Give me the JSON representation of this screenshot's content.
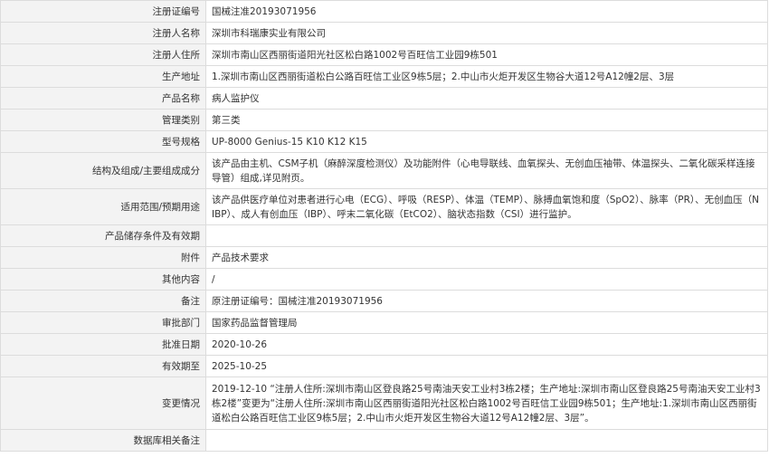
{
  "rows": [
    {
      "label": "注册证编号",
      "value": "国械注准20193071956"
    },
    {
      "label": "注册人名称",
      "value": "深圳市科瑞康实业有限公司"
    },
    {
      "label": "注册人住所",
      "value": "深圳市南山区西丽街道阳光社区松白路1002号百旺信工业园9栋501"
    },
    {
      "label": "生产地址",
      "value": "1.深圳市南山区西丽街道松白公路百旺信工业区9栋5层；2.中山市火炬开发区生物谷大道12号A12幢2层、3层"
    },
    {
      "label": "产品名称",
      "value": "病人监护仪"
    },
    {
      "label": "管理类别",
      "value": "第三类"
    },
    {
      "label": "型号规格",
      "value": "UP-8000 Genius-15 K10 K12 K15"
    },
    {
      "label": "结构及组成/主要组成成分",
      "value": "该产品由主机、CSM子机（麻醉深度检测仪）及功能附件（心电导联线、血氧探头、无创血压袖带、体温探头、二氧化碳采样连接导管）组成,详见附页。"
    },
    {
      "label": "适用范围/预期用途",
      "value": "该产品供医疗单位对患者进行心电（ECG）、呼吸（RESP）、体温（TEMP）、脉搏血氧饱和度（SpO2）、脉率（PR）、无创血压（NIBP）、成人有创血压（IBP）、呼末二氧化碳（EtCO2）、脑状态指数（CSI）进行监护。"
    },
    {
      "label": "产品储存条件及有效期",
      "value": ""
    },
    {
      "label": "附件",
      "value": "产品技术要求"
    },
    {
      "label": "其他内容",
      "value": "/"
    },
    {
      "label": "备注",
      "value": "原注册证编号：国械注准20193071956"
    },
    {
      "label": "审批部门",
      "value": "国家药品监督管理局"
    },
    {
      "label": "批准日期",
      "value": "2020-10-26"
    },
    {
      "label": "有效期至",
      "value": "2025-10-25"
    },
    {
      "label": "变更情况",
      "value": "2019-12-10 “注册人住所:深圳市南山区登良路25号南油天安工业村3栋2楼；生产地址:深圳市南山区登良路25号南油天安工业村3栋2楼”变更为“注册人住所:深圳市南山区西丽街道阳光社区松白路1002号百旺信工业园9栋501；生产地址:1.深圳市南山区西丽街道松白公路百旺信工业区9栋5层；2.中山市火炬开发区生物谷大道12号A12幢2层、3层”。"
    },
    {
      "label": "数据库相关备注",
      "value": ""
    }
  ]
}
